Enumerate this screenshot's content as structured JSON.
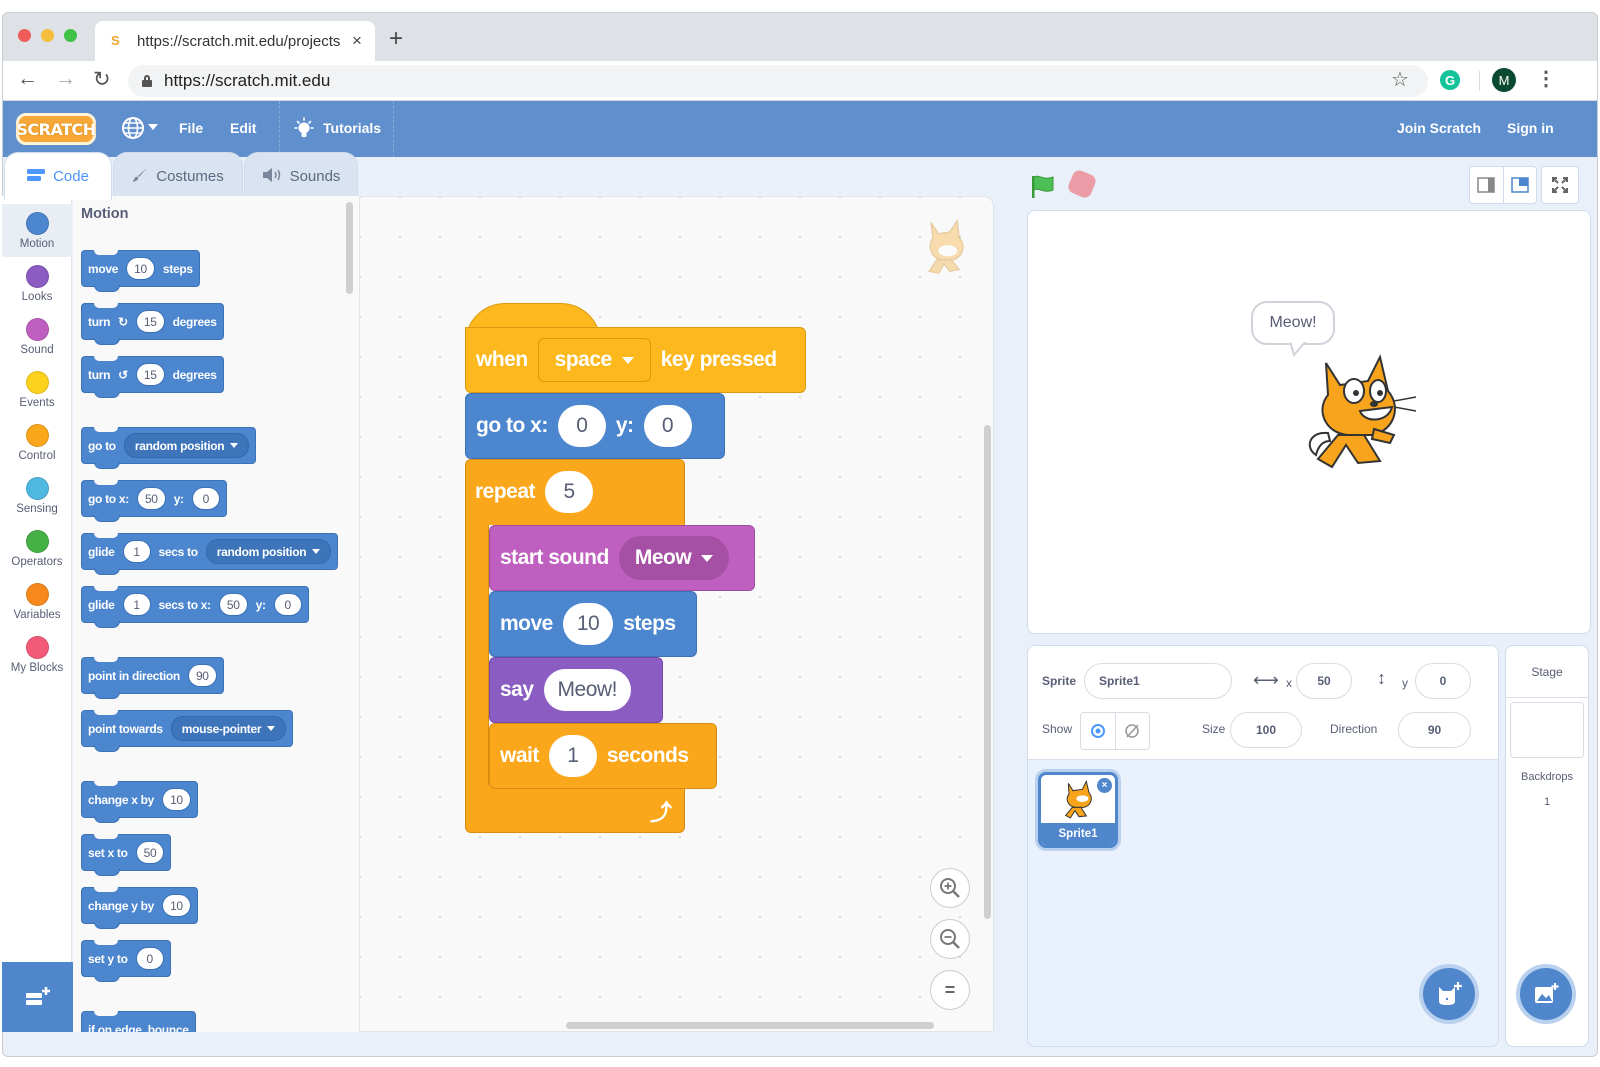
{
  "browser": {
    "tab_title": "https://scratch.mit.edu/projects",
    "tab_favicon": "scratch-favicon",
    "new_tab_symbol": "+",
    "close_symbol": "×",
    "url": "https://scratch.mit.edu",
    "back_symbol": "←",
    "forward_symbol": "→",
    "reload_symbol": "↻",
    "star_symbol": "☆",
    "grammarly_letter": "G",
    "profile_initial": "M",
    "menu_symbol": "⋮"
  },
  "menubar": {
    "logo_text": "SCRATCH",
    "globe_symbol": "🌐",
    "file_label": "File",
    "edit_label": "Edit",
    "tutorials_label": "Tutorials",
    "join_label": "Join Scratch",
    "signin_label": "Sign in"
  },
  "editor_tabs": [
    {
      "label": "Code",
      "active": true
    },
    {
      "label": "Costumes",
      "active": false
    },
    {
      "label": "Sounds",
      "active": false
    }
  ],
  "categories": [
    {
      "label": "Motion",
      "color": "#4c97ff",
      "active": true
    },
    {
      "label": "Looks",
      "color": "#9966ff"
    },
    {
      "label": "Sound",
      "color": "#cf63cf"
    },
    {
      "label": "Events",
      "color": "#ffd500"
    },
    {
      "label": "Control",
      "color": "#ffab19"
    },
    {
      "label": "Sensing",
      "color": "#5cb1d6"
    },
    {
      "label": "Operators",
      "color": "#59c059"
    },
    {
      "label": "Variables",
      "color": "#ff8c1a"
    },
    {
      "label": "My Blocks",
      "color": "#ff6680"
    }
  ],
  "flyout": {
    "title": "Motion",
    "blocks": {
      "move": {
        "a": "move",
        "v": "10",
        "b": "steps"
      },
      "turn_right": {
        "a": "turn",
        "v": "15",
        "b": "degrees"
      },
      "turn_left": {
        "a": "turn",
        "v": "15",
        "b": "degrees"
      },
      "goto": {
        "a": "go to",
        "menu": "random position"
      },
      "gotoxy": {
        "a": "go to x:",
        "x": "50",
        "b": "y:",
        "y": "0"
      },
      "glide_to": {
        "a": "glide",
        "v": "1",
        "b": "secs to",
        "menu": "random position"
      },
      "glide_xy": {
        "a": "glide",
        "v": "1",
        "b": "secs to x:",
        "x": "50",
        "c": "y:",
        "y": "0"
      },
      "point_dir": {
        "a": "point in direction",
        "v": "90"
      },
      "point_towards": {
        "a": "point towards",
        "menu": "mouse-pointer"
      },
      "change_x": {
        "a": "change x by",
        "v": "10"
      },
      "set_x": {
        "a": "set x to",
        "v": "50"
      },
      "change_y": {
        "a": "change y by",
        "v": "10"
      },
      "set_y": {
        "a": "set y to",
        "v": "0"
      },
      "bounce": {
        "a": "if on edge, bounce"
      }
    }
  },
  "script": {
    "hat": {
      "a": "when",
      "key": "space",
      "b": "key pressed"
    },
    "gotoxy": {
      "a": "go to x:",
      "x": "0",
      "b": "y:",
      "y": "0"
    },
    "repeat": {
      "a": "repeat",
      "v": "5"
    },
    "sound": {
      "a": "start sound",
      "menu": "Meow"
    },
    "move": {
      "a": "move",
      "v": "10",
      "b": "steps"
    },
    "say": {
      "a": "say",
      "v": "Meow!"
    },
    "wait": {
      "a": "wait",
      "v": "1",
      "b": "seconds"
    }
  },
  "zoom_controls": {
    "reset_symbol": "="
  },
  "stage": {
    "speech": "Meow!"
  },
  "sprite_info": {
    "sprite_label": "Sprite",
    "sprite_name": "Sprite1",
    "x_label": "x",
    "x_value": "50",
    "y_label": "y",
    "y_value": "0",
    "show_label": "Show",
    "size_label": "Size",
    "size_value": "100",
    "direction_label": "Direction",
    "direction_value": "90"
  },
  "sprites": [
    {
      "name": "Sprite1",
      "selected": true
    }
  ],
  "stage_pane": {
    "title": "Stage",
    "backdrops_label": "Backdrops",
    "backdrops_count": "1"
  }
}
